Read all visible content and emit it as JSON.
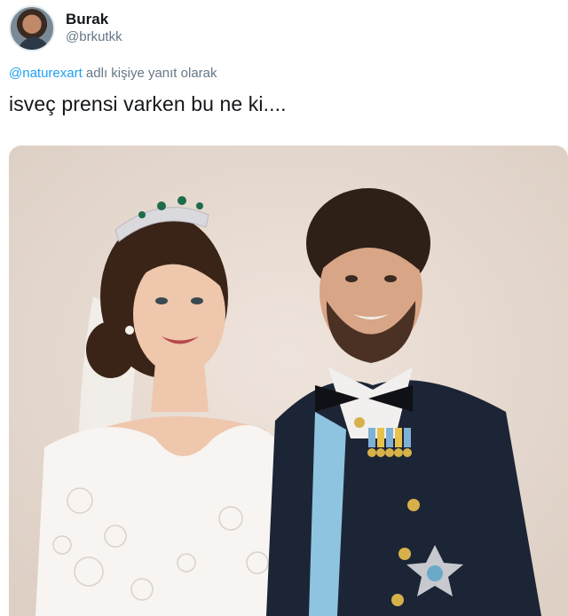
{
  "user": {
    "display_name": "Burak",
    "handle": "@brkutkk"
  },
  "reply": {
    "mention": "@naturexart",
    "suffix": " adlı kişiye yanıt olarak"
  },
  "tweet": {
    "text": "isveç prensi varken bu ne ki...."
  },
  "icons": {
    "avatar": "profile-photo"
  },
  "colors": {
    "link": "#1da1f2",
    "secondary_text": "#657786",
    "primary_text": "#14171a"
  }
}
